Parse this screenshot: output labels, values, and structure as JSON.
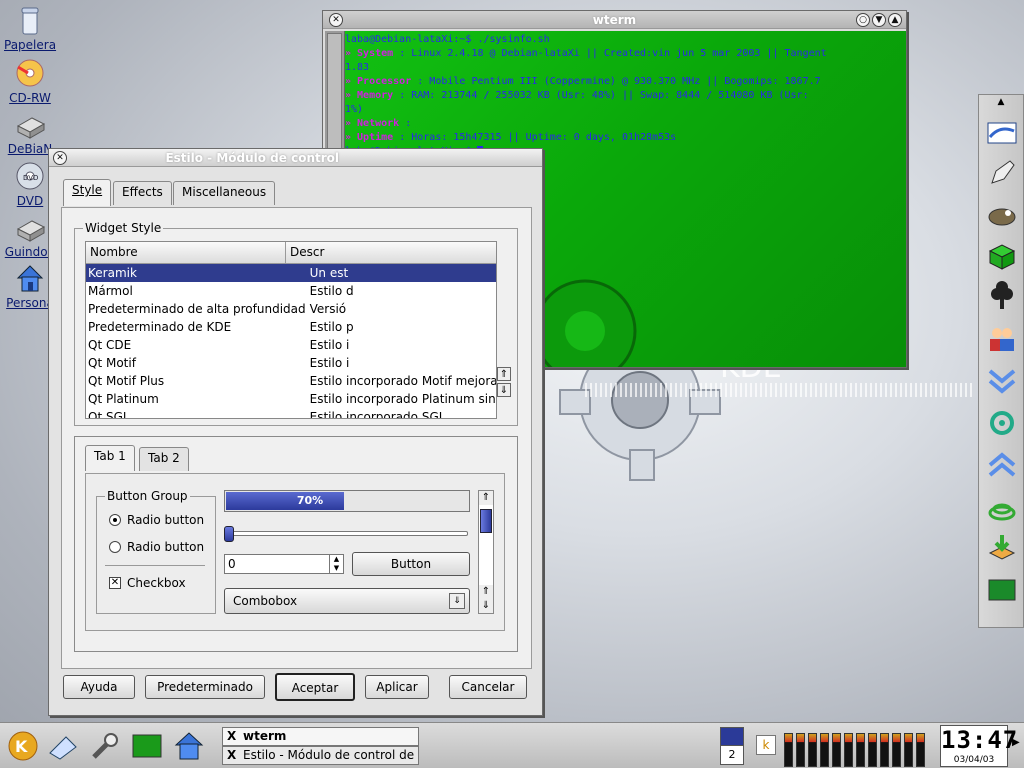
{
  "desktop": {
    "icons": [
      {
        "label": "Papelera",
        "icon": "trash-icon"
      },
      {
        "label": "CD-RW",
        "icon": "cdrw-icon"
      },
      {
        "label": "DeBiaN",
        "icon": "hard-drive-icon"
      },
      {
        "label": "DVD",
        "icon": "dvd-icon"
      },
      {
        "label": "Guindon",
        "icon": "hard-drive-icon"
      },
      {
        "label": "Persona",
        "icon": "home-icon"
      }
    ],
    "wallpaper_text": "KDE"
  },
  "terminal": {
    "title": "wterm",
    "lines": [
      {
        "label": "",
        "text": "laba@Debian-lataXi:~$ ./sysinfo.sh"
      },
      {
        "label": "» System",
        "text": ": Linux 2.4.18 @ Debian-lataXi || Created:vin jun 5 mar 2003 || Tangent"
      },
      {
        "label": "",
        "text": "  1.83"
      },
      {
        "label": "» Processor",
        "text": ": Mobile Pentium III (Coppermine) @ 930.370 MHz || Bogomips: 1867.7"
      },
      {
        "label": "",
        "text": ""
      },
      {
        "label": "» Memory",
        "text": ": RAM: 213744 / 255032 KB (Usr: 48%) || Swap: 8444 / 514080 KB (Usr:"
      },
      {
        "label": "",
        "text": "  1%)"
      },
      {
        "label": "» Network",
        "text": ":"
      },
      {
        "label": "» Uptime",
        "text": ": Horas: 15h47315 || Uptime: 0 days, 01h28m53s"
      },
      {
        "label": "",
        "text": "laba@Debian-lataXi:~$ "
      }
    ]
  },
  "dialog": {
    "title": "Estilo - Módulo de control",
    "tabs": [
      "Style",
      "Effects",
      "Miscellaneous"
    ],
    "widget_style_label": "Widget Style",
    "columns": [
      "Nombre",
      "Descr"
    ],
    "styles": [
      {
        "name": "Keramik",
        "desc": "Un est"
      },
      {
        "name": "Mármol",
        "desc": "Estilo d"
      },
      {
        "name": "Predeterminado de alta profundidad",
        "desc": "Versió"
      },
      {
        "name": "Predeterminado de KDE",
        "desc": "Estilo p"
      },
      {
        "name": "Qt CDE",
        "desc": "Estilo i"
      },
      {
        "name": "Qt Motif",
        "desc": "Estilo i"
      },
      {
        "name": "Qt Motif Plus",
        "desc": "Estilo incorporado Motif mejorado"
      },
      {
        "name": "Qt Platinum",
        "desc": "Estilo incorporado Platinum sin tema"
      },
      {
        "name": "Qt SGI",
        "desc": "Estilo incorporado SGI"
      }
    ],
    "preview": {
      "tabs": [
        "Tab 1",
        "Tab 2"
      ],
      "button_group": "Button Group",
      "radio1": "Radio button",
      "radio2": "Radio button",
      "checkbox": "Checkbox",
      "progress_text": "70%",
      "progress": 0.7,
      "spin_value": "0",
      "button": "Button",
      "combobox": "Combobox"
    },
    "buttons": [
      "Ayuda",
      "Predeterminado",
      "Aceptar",
      "Aplicar",
      "Cancelar"
    ]
  },
  "taskbar": {
    "tasks": [
      "wterm",
      "Estilo - Módulo de control de KD"
    ],
    "pager_number": "2",
    "clock": "13:47",
    "date": "03/04/03"
  }
}
